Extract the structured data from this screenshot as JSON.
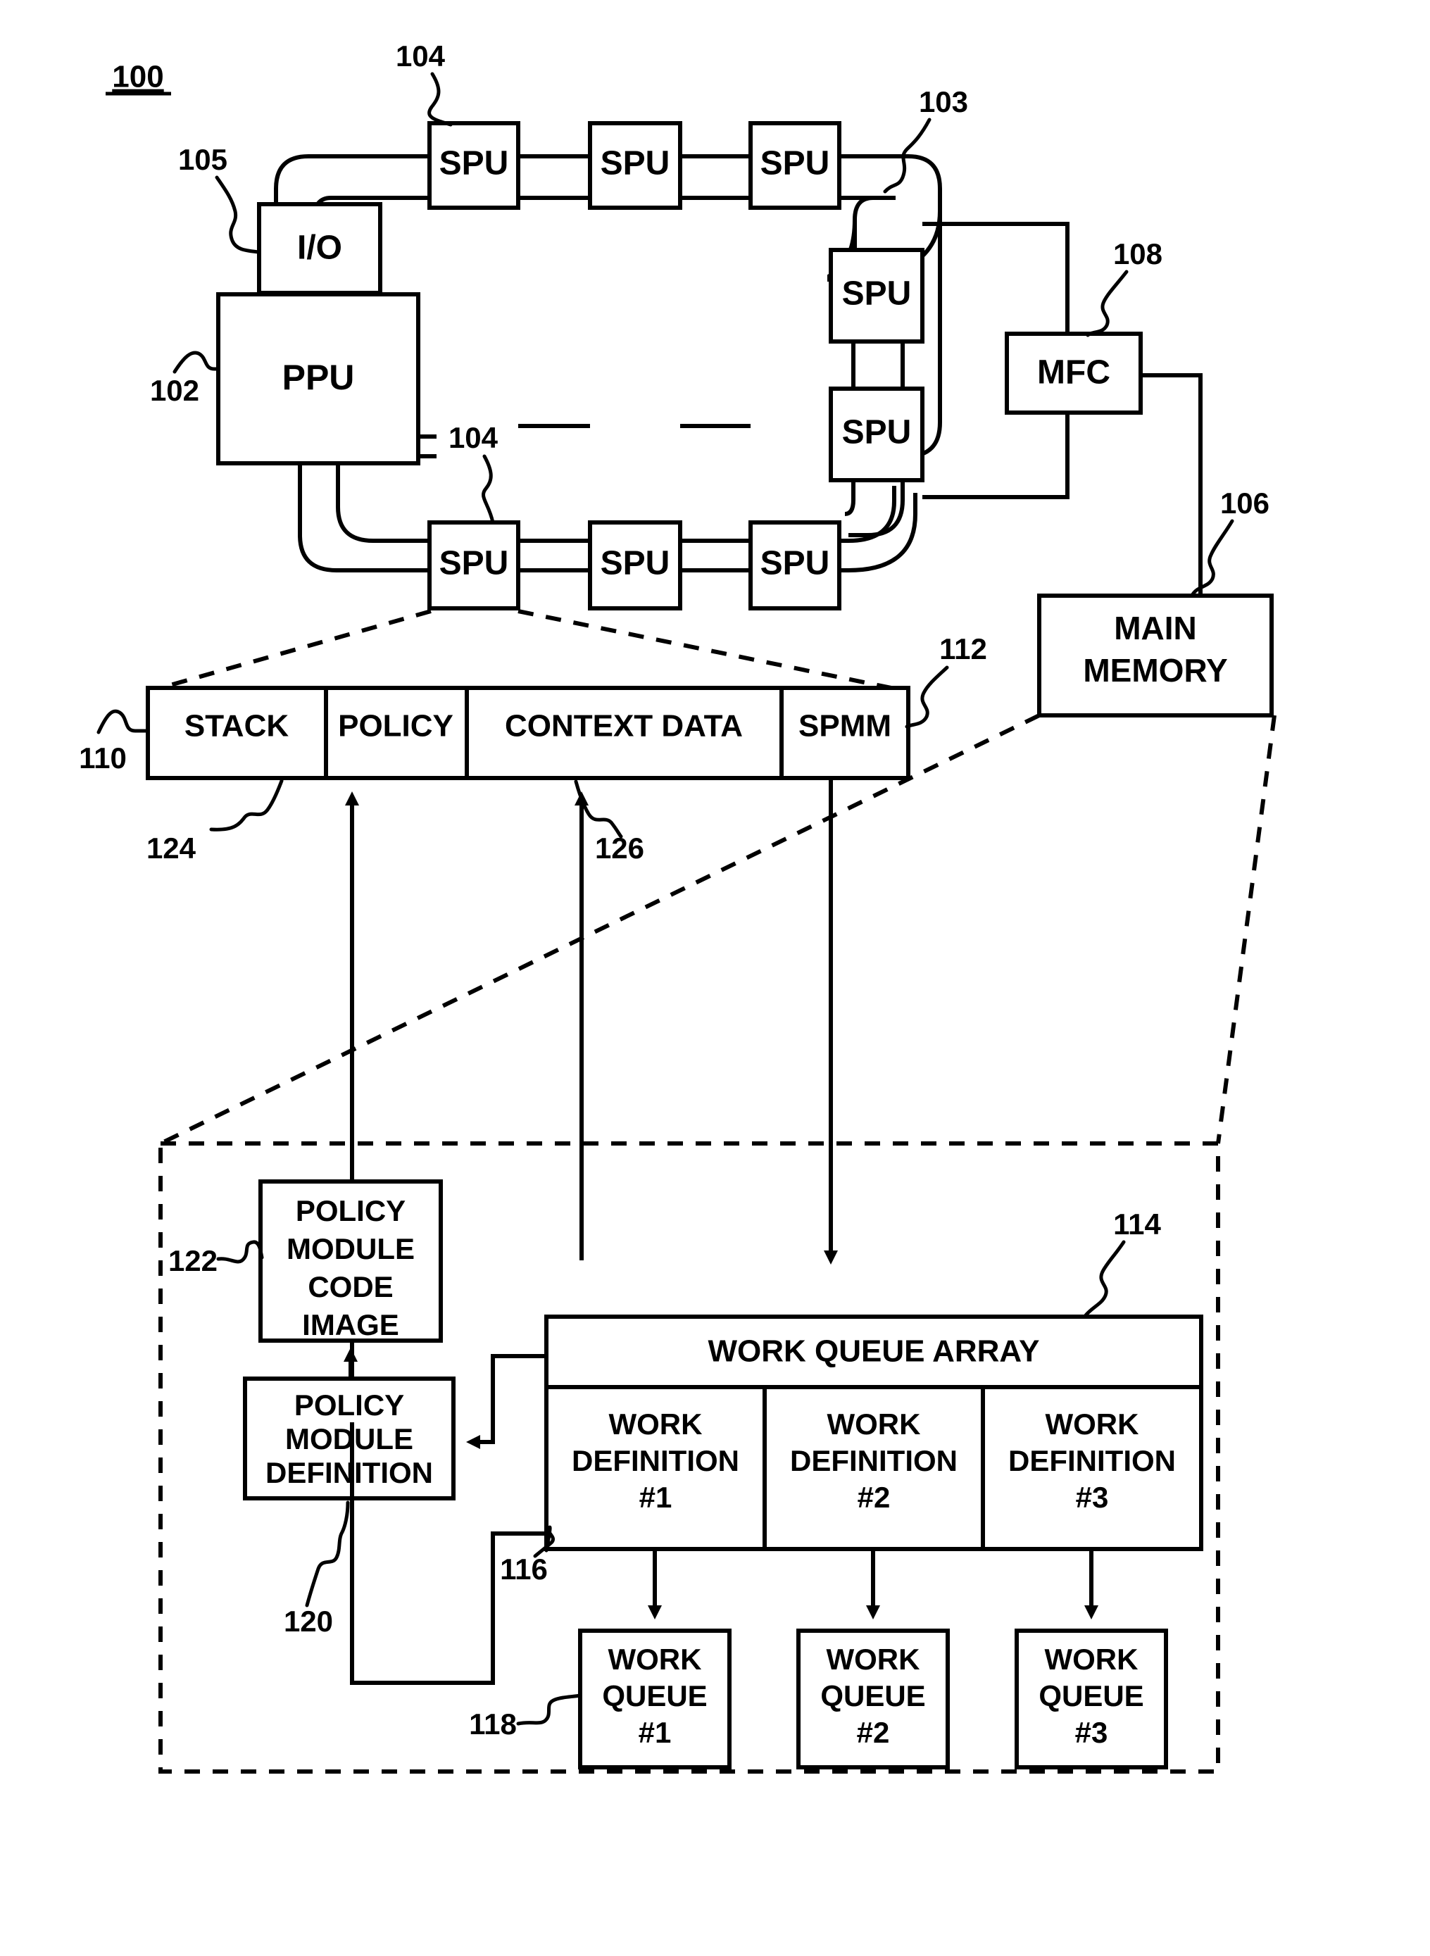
{
  "figure": {
    "number": "100",
    "title_ref": "100"
  },
  "processor": {
    "ppu": {
      "label": "PPU",
      "ref": "102"
    },
    "io": {
      "label": "I/O",
      "ref": "105"
    },
    "bus": {
      "ref": "103"
    },
    "mfc": {
      "label": "MFC",
      "ref": "108"
    },
    "main_memory": {
      "label_line1": "MAIN",
      "label_line2": "MEMORY",
      "ref": "106"
    },
    "spu_ref_top": "104",
    "spu_ref_bottom": "104",
    "spus": [
      {
        "label": "SPU",
        "position": "top-1"
      },
      {
        "label": "SPU",
        "position": "top-2"
      },
      {
        "label": "SPU",
        "position": "top-3"
      },
      {
        "label": "SPU",
        "position": "right-1"
      },
      {
        "label": "SPU",
        "position": "right-2"
      },
      {
        "label": "SPU",
        "position": "bottom-1"
      },
      {
        "label": "SPU",
        "position": "bottom-2"
      },
      {
        "label": "SPU",
        "position": "bottom-3"
      }
    ]
  },
  "local_store": {
    "ref": "110",
    "spmm_ref": "112",
    "policy_ref": "124",
    "context_ref": "126",
    "segments": [
      {
        "label": "STACK"
      },
      {
        "label": "POLICY"
      },
      {
        "label": "CONTEXT DATA"
      },
      {
        "label": "SPMM"
      }
    ]
  },
  "memory_detail": {
    "policy_module_code_image": {
      "line1": "POLICY",
      "line2": "MODULE",
      "line3": "CODE",
      "line4": "IMAGE",
      "ref": "122"
    },
    "policy_module_definition": {
      "line1": "POLICY",
      "line2": "MODULE",
      "line3": "DEFINITION",
      "ref": "120"
    },
    "work_queue_array": {
      "label": "WORK QUEUE ARRAY",
      "ref": "114",
      "definition_ref": "116",
      "definitions": [
        {
          "line1": "WORK",
          "line2": "DEFINITION",
          "line3": "#1"
        },
        {
          "line1": "WORK",
          "line2": "DEFINITION",
          "line3": "#2"
        },
        {
          "line1": "WORK",
          "line2": "DEFINITION",
          "line3": "#3"
        }
      ]
    },
    "work_queues": {
      "ref": "118",
      "items": [
        {
          "line1": "WORK",
          "line2": "QUEUE",
          "line3": "#1"
        },
        {
          "line1": "WORK",
          "line2": "QUEUE",
          "line3": "#2"
        },
        {
          "line1": "WORK",
          "line2": "QUEUE",
          "line3": "#3"
        }
      ]
    }
  },
  "colors": {
    "ink": "#000000",
    "paper": "#ffffff"
  }
}
